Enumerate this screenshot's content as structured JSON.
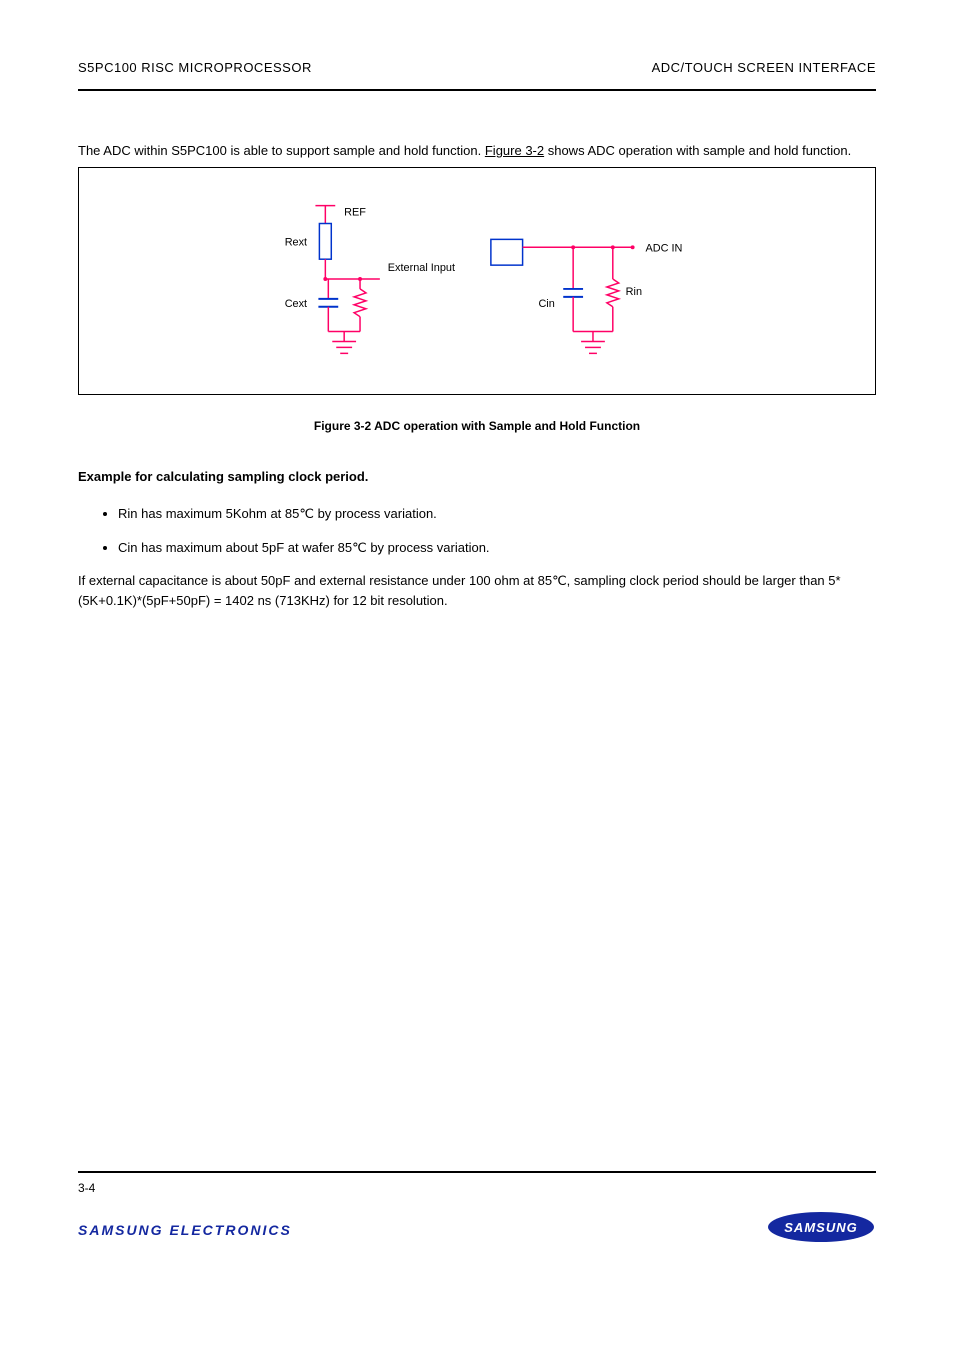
{
  "header": {
    "left": "S5PC100 RISC MICROPROCESSOR",
    "right": "ADC/TOUCH SCREEN INTERFACE"
  },
  "intro_para_prefix": "The ADC within S5PC100 is able to support sample and hold function. ",
  "figure_ref": "Figure 3-2",
  "intro_para_suffix": " shows ADC operation with sample and hold function.",
  "fig": {
    "ref": "REF",
    "ext_input": "External Input",
    "r_ext": "Rext",
    "c_ext": "Cext",
    "c_in": "Cin",
    "r_in": "Rin",
    "adc_in": "ADC IN",
    "caption_label": "Figure 3-2 ",
    "caption_text": "ADC operation with Sample and Hold Function"
  },
  "example": {
    "title": "Example for calculating sampling clock period.",
    "bullet1": "Rin has maximum 5Kohm at 85℃ by process variation.",
    "bullet2": "Cin has maximum about 5pF at wafer 85℃ by process variation.",
    "para": "If external capacitance is about 50pF and external resistance under 100 ohm at 85℃, sampling clock period should be larger than 5*(5K+0.1K)*(5pF+50pF) = 1402 ns (713KHz) for 12 bit resolution."
  },
  "footer": {
    "page": "3-4",
    "left_brand": "SAMSUNG ELECTRONICS",
    "right_brand": "SAMSUNG"
  }
}
